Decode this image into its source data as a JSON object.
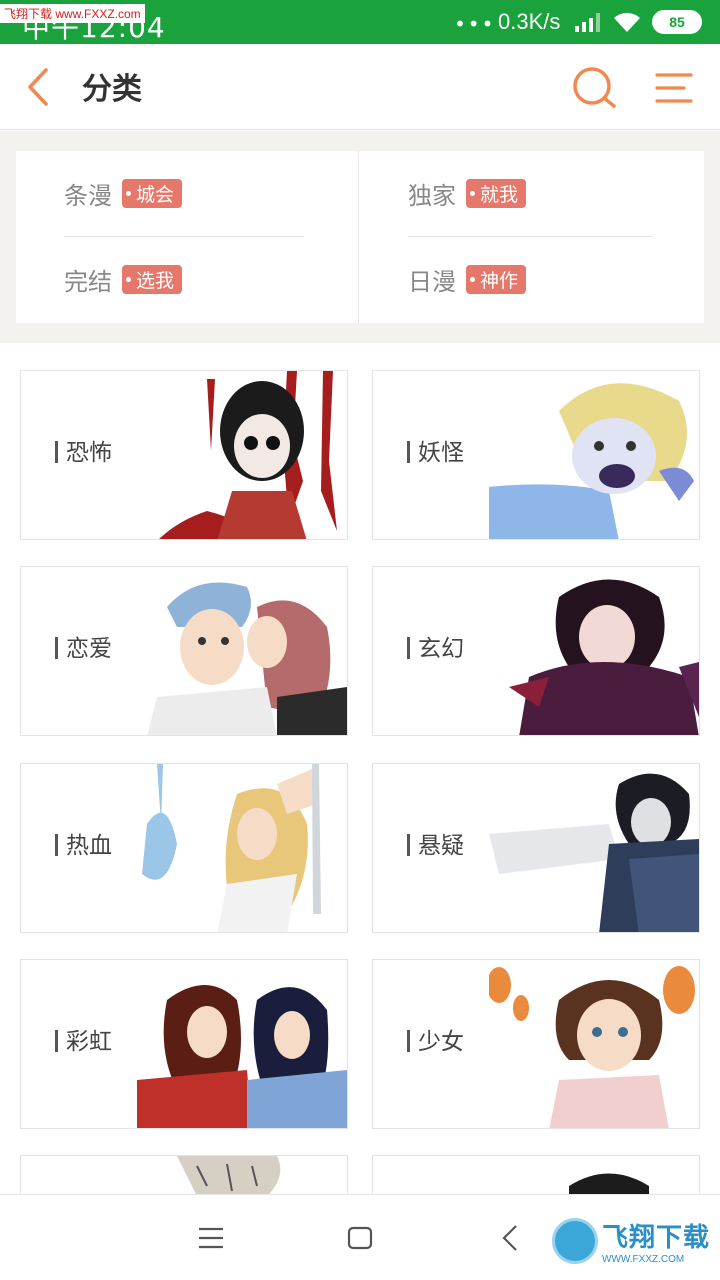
{
  "status_bar": {
    "time": "中午12:04",
    "watermark": "飞翔下载 www.FXXZ.com",
    "dots": "•••",
    "net_speed": "0.3K/s",
    "battery": "85"
  },
  "header": {
    "title": "分类",
    "back_icon": "chevron-left-icon",
    "search_icon": "search-icon",
    "menu_icon": "menu-icon",
    "accent_color": "#f0894f"
  },
  "tags": [
    {
      "label": "条漫",
      "badge": "城会"
    },
    {
      "label": "独家",
      "badge": "就我"
    },
    {
      "label": "完结",
      "badge": "选我"
    },
    {
      "label": "日漫",
      "badge": "神作"
    }
  ],
  "categories": [
    {
      "label": "恐怖"
    },
    {
      "label": "妖怪"
    },
    {
      "label": "恋爱"
    },
    {
      "label": "玄幻"
    },
    {
      "label": "热血"
    },
    {
      "label": "悬疑"
    },
    {
      "label": "彩虹"
    },
    {
      "label": "少女"
    },
    {
      "label": ""
    },
    {
      "label": ""
    }
  ],
  "bottom_nav": {
    "menu_icon": "menu-icon",
    "home_icon": "square-home-icon",
    "back_icon": "triangle-back-icon",
    "watermark": {
      "main": "飞翔下载",
      "sub": "WWW.FXXZ.COM"
    }
  },
  "colors": {
    "status_bar": "#1aa33d",
    "badge": "#e5786a",
    "accent": "#f0894f"
  }
}
